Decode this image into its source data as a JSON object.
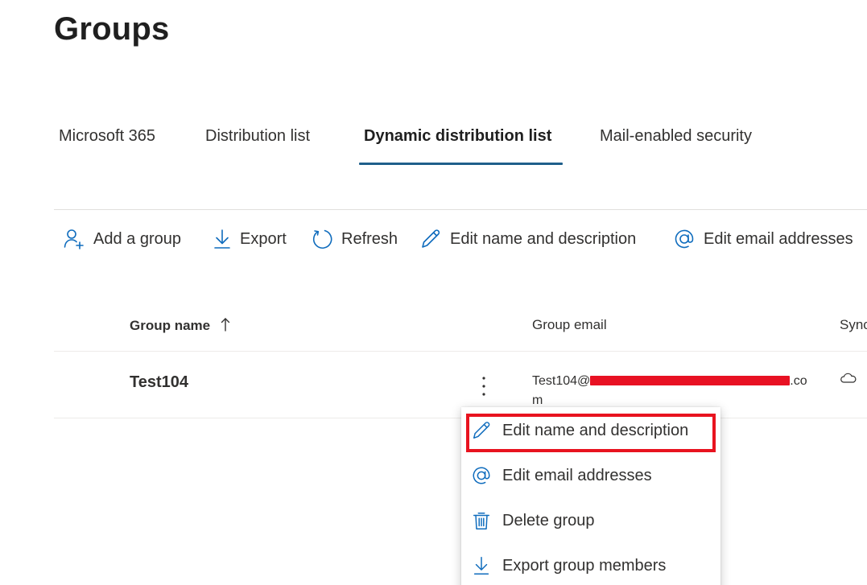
{
  "page": {
    "title": "Groups"
  },
  "tabs": [
    {
      "label": "Microsoft 365",
      "active": false
    },
    {
      "label": "Distribution list",
      "active": false
    },
    {
      "label": "Dynamic distribution list",
      "active": true
    },
    {
      "label": "Mail-enabled security",
      "active": false
    }
  ],
  "toolbar": {
    "add_group": "Add a group",
    "export": "Export",
    "refresh": "Refresh",
    "edit_name": "Edit name and description",
    "edit_email": "Edit email addresses"
  },
  "table": {
    "headers": {
      "group_name": "Group name",
      "group_email": "Group email",
      "sync": "Sync"
    },
    "rows": [
      {
        "name": "Test104",
        "email_prefix": "Test104@",
        "email_suffix": ".co",
        "email_wrap": "m",
        "sync_icon": "cloud-icon"
      }
    ]
  },
  "context_menu": {
    "items": [
      {
        "label": "Edit name and description",
        "icon": "pencil-icon",
        "highlighted": true
      },
      {
        "label": "Edit email addresses",
        "icon": "at-sign-icon"
      },
      {
        "label": "Delete group",
        "icon": "trash-icon"
      },
      {
        "label": "Export group members",
        "icon": "download-icon"
      }
    ]
  },
  "colors": {
    "accent": "#1f5f8b",
    "icon_blue": "#0f6cbd",
    "highlight": "#e8131f",
    "redaction": "#e81123"
  }
}
